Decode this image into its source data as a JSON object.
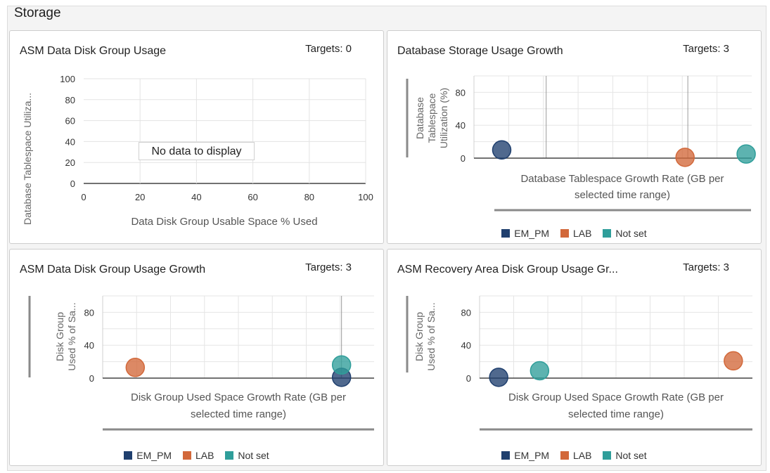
{
  "section_title": "Storage",
  "colors": {
    "EM_PM": "#1f3f6e",
    "LAB": "#d2683a",
    "Not set": "#2f9e9a"
  },
  "panels": [
    {
      "title": "ASM Data Disk Group Usage",
      "targets": "Targets: 0",
      "no_data": "No data to display"
    },
    {
      "title": "Database Storage Usage Growth",
      "targets": "Targets: 3",
      "legend": [
        "EM_PM",
        "LAB",
        "Not set"
      ]
    },
    {
      "title": "ASM Data Disk Group Usage Growth",
      "targets": "Targets: 3",
      "legend": [
        "EM_PM",
        "LAB",
        "Not set"
      ]
    },
    {
      "title": "ASM Recovery Area Disk Group Usage Gr...",
      "targets": "Targets: 3",
      "legend": [
        "EM_PM",
        "LAB",
        "Not set"
      ]
    }
  ],
  "chart_data": [
    {
      "type": "scatter",
      "title": "ASM Data Disk Group Usage",
      "xlabel": "Data Disk Group Usable Space % Used",
      "ylabel": "Database Tablespace Utiliza...",
      "xlim": [
        0,
        100
      ],
      "ylim": [
        0,
        100
      ],
      "x_ticks": [
        "0",
        "20",
        "40",
        "60",
        "80",
        "100"
      ],
      "y_ticks": [
        "100",
        "80",
        "60",
        "40",
        "20",
        "0"
      ],
      "series": []
    },
    {
      "type": "scatter",
      "title": "Database Storage Usage Growth",
      "xlabel_lines": [
        "Database Tablespace Growth Rate (GB per",
        "selected time range)"
      ],
      "ylabel_lines": [
        "Database",
        "Tablespace",
        "Utilization (%)"
      ],
      "ylim": [
        0,
        100
      ],
      "y_ticks": [
        "80",
        "40",
        "0"
      ],
      "series": [
        {
          "name": "EM_PM",
          "x": 0.1,
          "y": 10
        },
        {
          "name": "LAB",
          "x": 0.76,
          "y": 1
        },
        {
          "name": "Not set",
          "x": 0.98,
          "y": 5
        }
      ]
    },
    {
      "type": "scatter",
      "title": "ASM Data Disk Group Usage Growth",
      "xlabel_lines": [
        "Disk Group Used Space Growth Rate (GB per",
        "selected time range)"
      ],
      "ylabel_lines": [
        "Disk Group",
        "Used % of Sa..."
      ],
      "ylim": [
        0,
        100
      ],
      "y_ticks": [
        "80",
        "40",
        "0"
      ],
      "series": [
        {
          "name": "EM_PM",
          "x": 0.88,
          "y": 1
        },
        {
          "name": "LAB",
          "x": 0.12,
          "y": 13
        },
        {
          "name": "Not set",
          "x": 0.88,
          "y": 16
        }
      ]
    },
    {
      "type": "scatter",
      "title": "ASM Recovery Area Disk Group Usage Gr...",
      "xlabel_lines": [
        "Disk Group Used Space Growth Rate (GB per",
        "selected time range)"
      ],
      "ylabel_lines": [
        "Disk Group",
        "Used % of Sa..."
      ],
      "ylim": [
        0,
        100
      ],
      "y_ticks": [
        "80",
        "40",
        "0"
      ],
      "series": [
        {
          "name": "EM_PM",
          "x": 0.07,
          "y": 1
        },
        {
          "name": "LAB",
          "x": 0.93,
          "y": 21
        },
        {
          "name": "Not set",
          "x": 0.22,
          "y": 9
        }
      ]
    }
  ]
}
